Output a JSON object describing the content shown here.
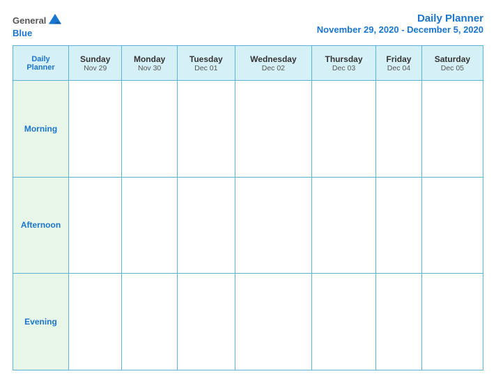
{
  "header": {
    "logo_general": "General",
    "logo_blue": "Blue",
    "title": "Daily Planner",
    "date_range": "November 29, 2020 - December 5, 2020"
  },
  "table": {
    "planner_label_line1": "Daily",
    "planner_label_line2": "Planner",
    "columns": [
      {
        "day": "Sunday",
        "date": "Nov 29"
      },
      {
        "day": "Monday",
        "date": "Nov 30"
      },
      {
        "day": "Tuesday",
        "date": "Dec 01"
      },
      {
        "day": "Wednesday",
        "date": "Dec 02"
      },
      {
        "day": "Thursday",
        "date": "Dec 03"
      },
      {
        "day": "Friday",
        "date": "Dec 04"
      },
      {
        "day": "Saturday",
        "date": "Dec 05"
      }
    ],
    "rows": [
      {
        "label": "Morning"
      },
      {
        "label": "Afternoon"
      },
      {
        "label": "Evening"
      }
    ]
  }
}
